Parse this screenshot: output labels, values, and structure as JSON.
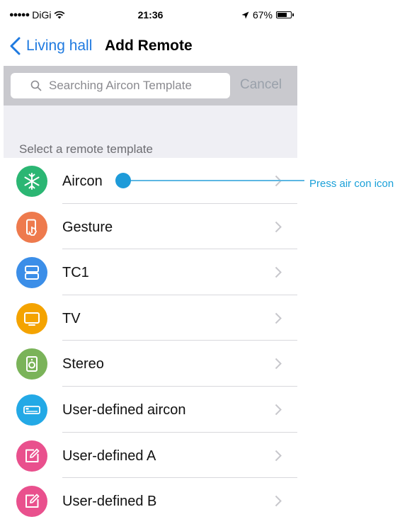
{
  "status_bar": {
    "signal_dots": "●●●●●",
    "carrier": "DiGi",
    "time": "21:36",
    "battery_percent": "67%",
    "battery_level": 0.67
  },
  "nav": {
    "back_label": "Living hall",
    "title": "Add Remote"
  },
  "search": {
    "placeholder": "Searching Aircon Template",
    "value": "",
    "cancel_label": "Cancel"
  },
  "section": {
    "title": "Select a remote template"
  },
  "templates": [
    {
      "label": "Aircon",
      "icon": "snowflake-icon",
      "color": "#2bb673"
    },
    {
      "label": "Gesture",
      "icon": "phone-touch-icon",
      "color": "#ee7a4d"
    },
    {
      "label": "TC1",
      "icon": "stacked-panels-icon",
      "color": "#3b8ee8"
    },
    {
      "label": "TV",
      "icon": "tv-icon",
      "color": "#f4a300"
    },
    {
      "label": "Stereo",
      "icon": "speaker-icon",
      "color": "#7ab359"
    },
    {
      "label": "User-defined aircon",
      "icon": "aircon-unit-icon",
      "color": "#23a9e6"
    },
    {
      "label": "User-defined A",
      "icon": "edit-icon",
      "color": "#e9508d"
    },
    {
      "label": "User-defined B",
      "icon": "edit-icon",
      "color": "#e9508d"
    }
  ],
  "annotation": {
    "text": "Press air con icon",
    "color": "#1aa0d8"
  }
}
